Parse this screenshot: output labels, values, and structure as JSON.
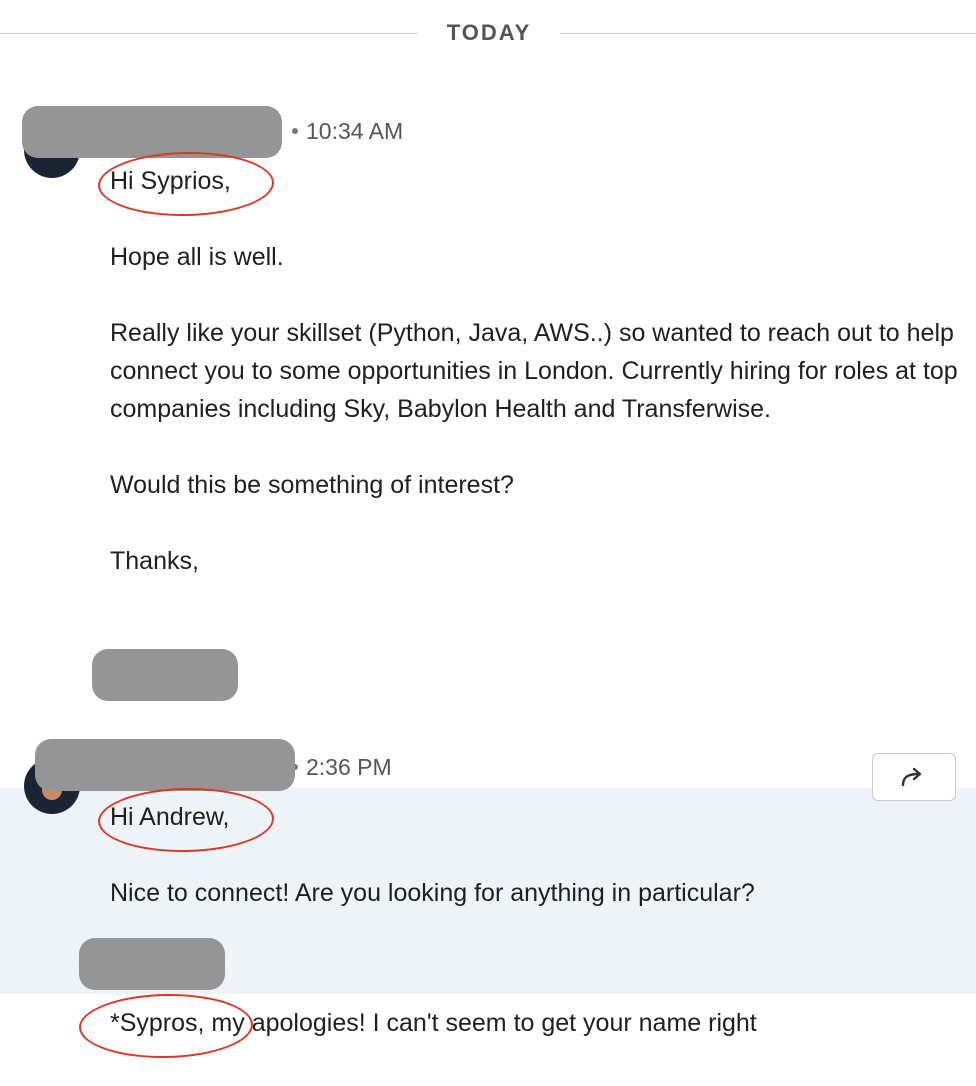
{
  "divider": {
    "label": "TODAY"
  },
  "messages": [
    {
      "time": "10:34 AM",
      "greeting": "Hi Syprios,",
      "paragraphs": [
        "Hope all is well.",
        "Really like your skillset (Python, Java, AWS..) so wanted to reach out to help connect you to some opportunities in London. Currently hiring for roles at top companies including Sky, Babylon Health and Transferwise.",
        "Would this be something of interest?",
        "Thanks,"
      ]
    },
    {
      "time": "2:36 PM",
      "greeting": "Hi Andrew,",
      "paragraphs": [
        "Nice to connect! Are you looking for anything in particular?"
      ]
    },
    {
      "text": "*Sypros, my apologies! I can't seem to get your name right"
    }
  ],
  "share_button": {
    "icon": "forward-arrow-icon"
  },
  "colors": {
    "highlight_band": "#eef3f8",
    "annotation_red": "#d93a25",
    "redaction_gray": "#959595"
  }
}
